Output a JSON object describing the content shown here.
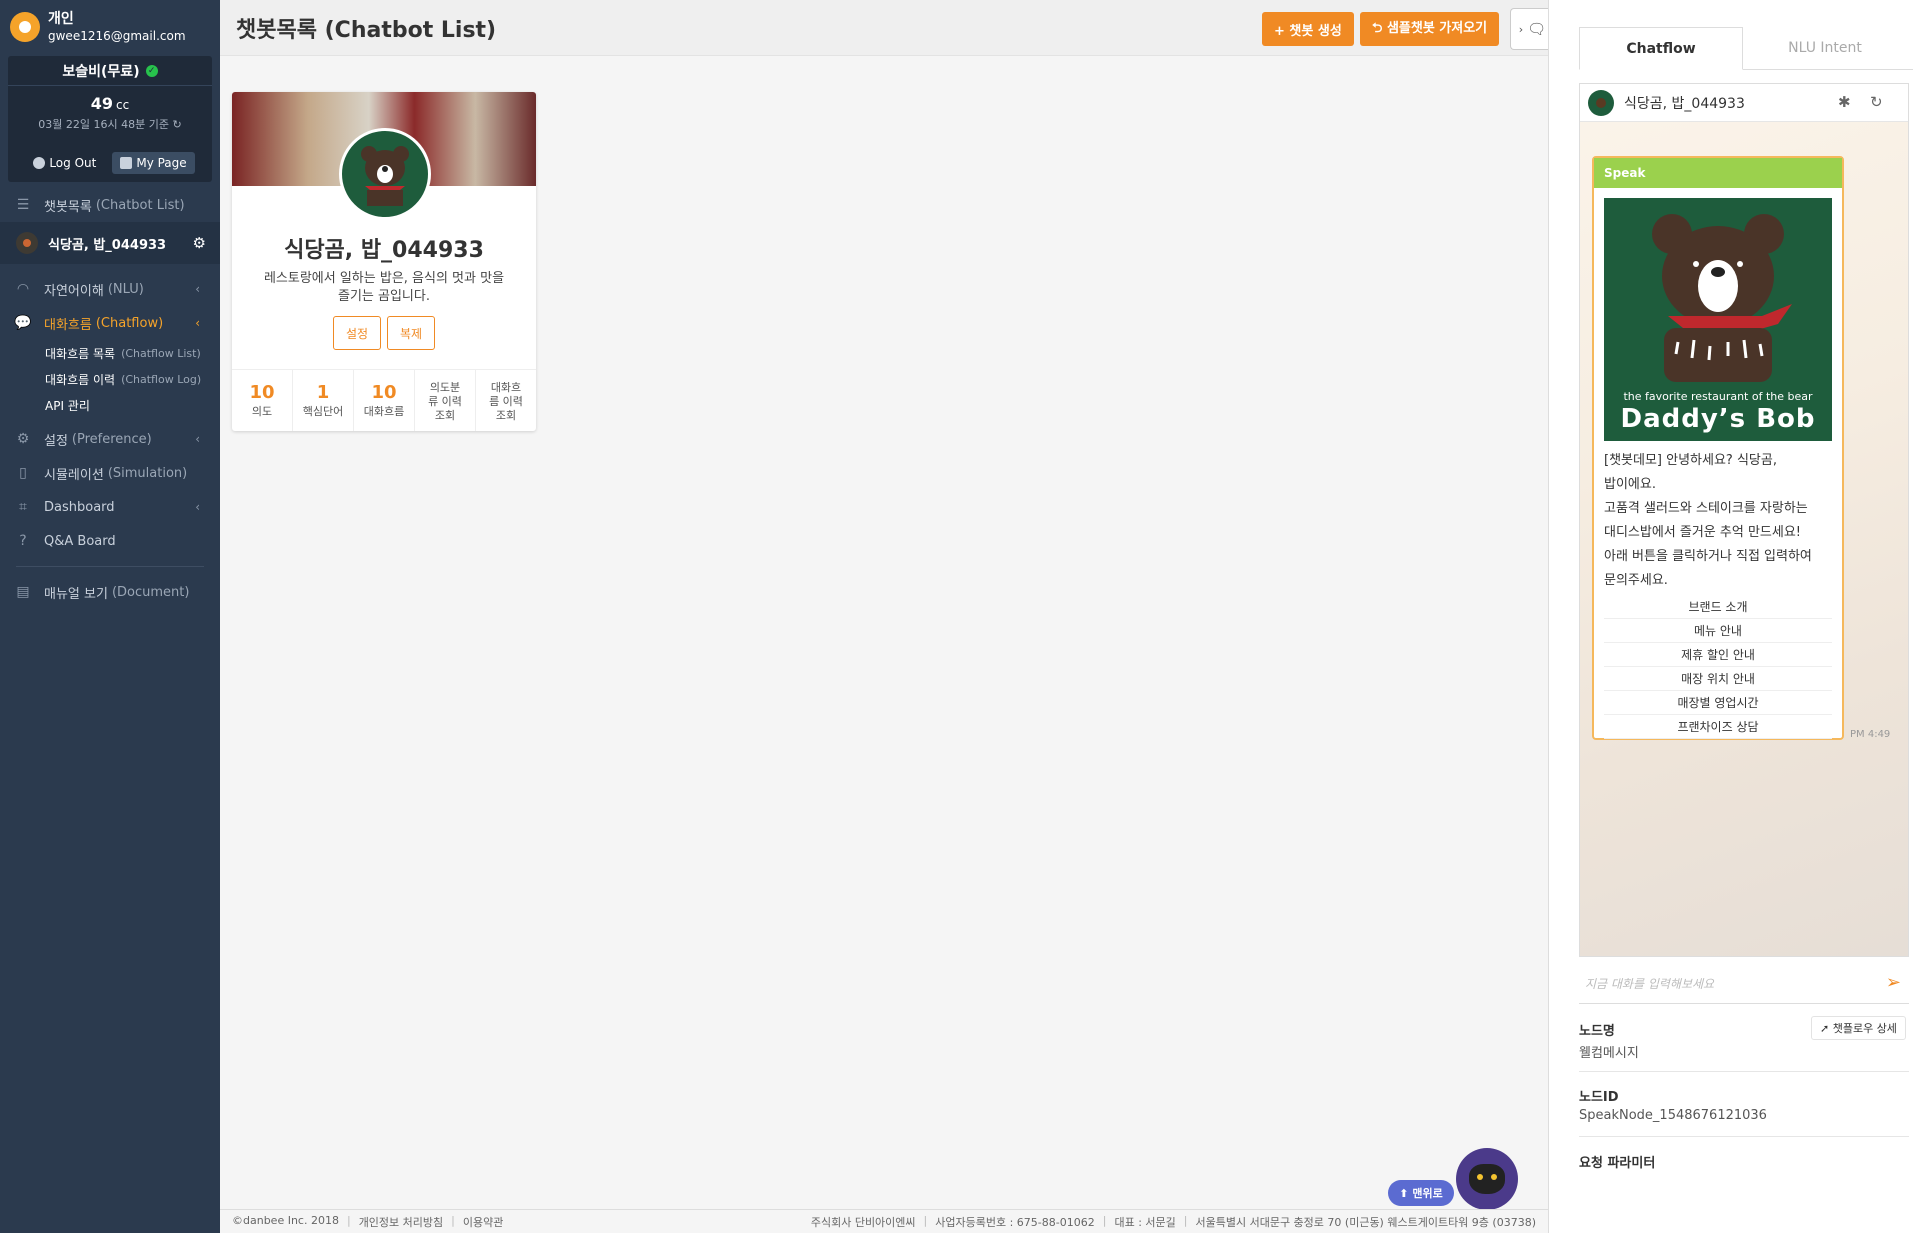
{
  "profile": {
    "type_label": "개인",
    "email": "gwee1216@gmail.com",
    "plan": "보슬비(무료)",
    "credit_value": "49",
    "credit_unit": "cc",
    "credit_date": "03월 22일 16시 48분 기준",
    "logout_label": "Log Out",
    "mypage_label": "My Page"
  },
  "sidebar": {
    "chatbot_list": {
      "label": "챗봇목록",
      "sub": "(Chatbot List)"
    },
    "current_bot": "식당곰, 밥_044933",
    "nlu": {
      "label": "자연어이해",
      "sub": "(NLU)"
    },
    "chatflow": {
      "label": "대화흐름",
      "sub": "(Chatflow)"
    },
    "chatflow_list": {
      "label": "대화흐름 목록",
      "sub": "(Chatflow List)"
    },
    "chatflow_log": {
      "label": "대화흐름 이력",
      "sub": "(Chatflow Log)"
    },
    "api": {
      "label": "API 관리"
    },
    "preference": {
      "label": "설정",
      "sub": "(Preference)"
    },
    "simulation": {
      "label": "시뮬레이션",
      "sub": "(Simulation)"
    },
    "dashboard": {
      "label": "Dashboard"
    },
    "qa": {
      "label": "Q&A Board"
    },
    "manual": {
      "label": "매뉴얼 보기",
      "sub": "(Document)"
    }
  },
  "header": {
    "title": "챗봇목록 (Chatbot List)",
    "create_label": "+ 챗봇 생성",
    "sample_label": "⮌ 샘플챗봇 가져오기"
  },
  "card": {
    "title": "식당곰, 밥_044933",
    "desc": "레스토랑에서 일하는 밥은, 음식의 멋과 맛을 즐기는 곰입니다.",
    "settings_label": "설정",
    "copy_label": "복제",
    "stats": [
      {
        "num": "10",
        "label": "의도"
      },
      {
        "num": "1",
        "label": "핵심단어"
      },
      {
        "num": "10",
        "label": "대화흐름"
      },
      {
        "num": "",
        "label": "의도분류 이력조회"
      },
      {
        "num": "",
        "label": "대화흐름 이력조회"
      }
    ]
  },
  "footer": {
    "copyright": "©danbee Inc. 2018",
    "privacy": "개인정보 처리방침",
    "terms": "이용약관",
    "company": "주식회사 단비아이엔씨",
    "biz_no": "사업자등록번호 : 675-88-01062",
    "ceo": "대표 : 서문길",
    "address": "서울특별시 서대문구 충정로 70 (미근동) 웨스트게이트타워 9층 (03738)"
  },
  "float": {
    "top_label": "⬆ 맨위로"
  },
  "panel": {
    "tab_chatflow": "Chatflow",
    "tab_nlu": "NLU Intent",
    "bot_name": "식당곰, 밥_044933",
    "speak_label": "Speak",
    "img_caption_small": "the favorite restaurant of the bear",
    "img_caption_big": "Daddy’s Bob",
    "message_lines": [
      "[챗봇데모] 안녕하세요? 식당곰,",
      "밥이에요.",
      "고품격 샐러드와 스테이크를 자랑하는",
      "대디스밥에서 즐거운 추억 만드세요!",
      "아래 버튼을 클릭하거나 직접 입력하여",
      "문의주세요."
    ],
    "quick_replies": [
      "브랜드 소개",
      "메뉴 안내",
      "제휴 할인 안내",
      "매장 위치 안내",
      "매장별 영업시간",
      "프랜차이즈 상담"
    ],
    "time": "PM 4:49",
    "input_placeholder": "지금 대화를 입력해보세요",
    "node_name_label": "노드명",
    "node_name_value": "웰컴메시지",
    "flow_detail_label": "➚ 챗플로우 상세",
    "node_id_label": "노드ID",
    "node_id_value": "SpeakNode_1548676121036",
    "params_label": "요청 파라미터"
  },
  "colors": {
    "sidebar_bg": "#2b3a4e",
    "accent": "#f08a24",
    "speak_green": "#9bd14d",
    "bear_bg": "#1e5c3c"
  }
}
